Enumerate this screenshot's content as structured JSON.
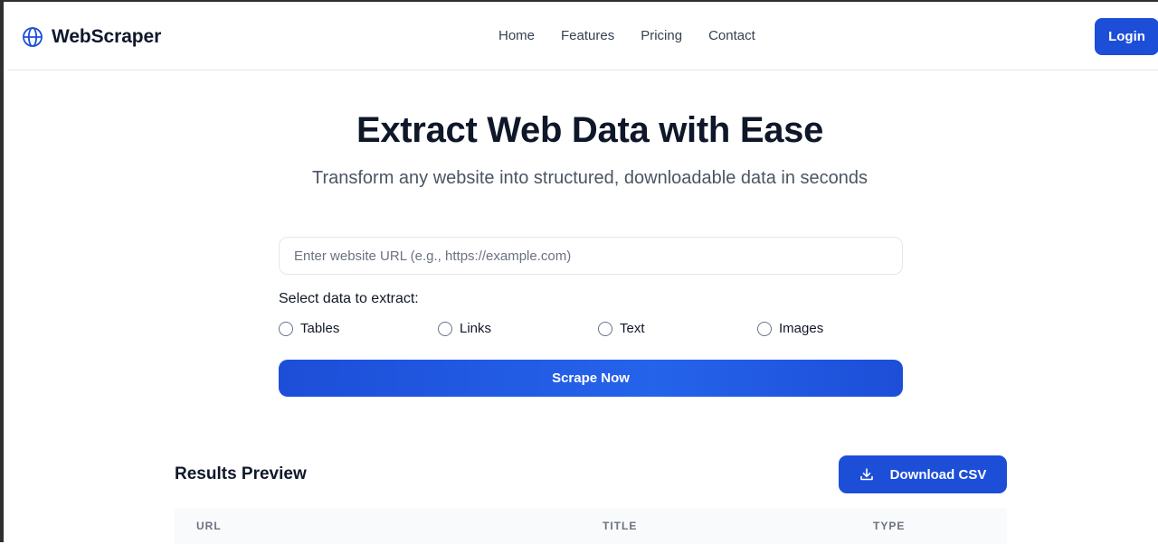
{
  "header": {
    "brand": "WebScraper",
    "brand_icon": "globe-icon",
    "nav": [
      "Home",
      "Features",
      "Pricing",
      "Contact"
    ],
    "login_label": "Login"
  },
  "hero": {
    "title": "Extract Web Data with Ease",
    "subtitle": "Transform any website into structured, downloadable data in seconds"
  },
  "form": {
    "url_placeholder": "Enter website URL (e.g., https://example.com)",
    "url_value": "",
    "select_label": "Select data to extract:",
    "options": [
      {
        "label": "Tables",
        "checked": false
      },
      {
        "label": "Links",
        "checked": false
      },
      {
        "label": "Text",
        "checked": false
      },
      {
        "label": "Images",
        "checked": false
      }
    ],
    "submit_label": "Scrape Now"
  },
  "results": {
    "title": "Results Preview",
    "download_label": "Download CSV",
    "download_icon": "download-icon",
    "columns": [
      "URL",
      "TITLE",
      "TYPE"
    ]
  },
  "colors": {
    "accent": "#1d4ed8",
    "text": "#0f172a",
    "muted": "#4b5563"
  }
}
